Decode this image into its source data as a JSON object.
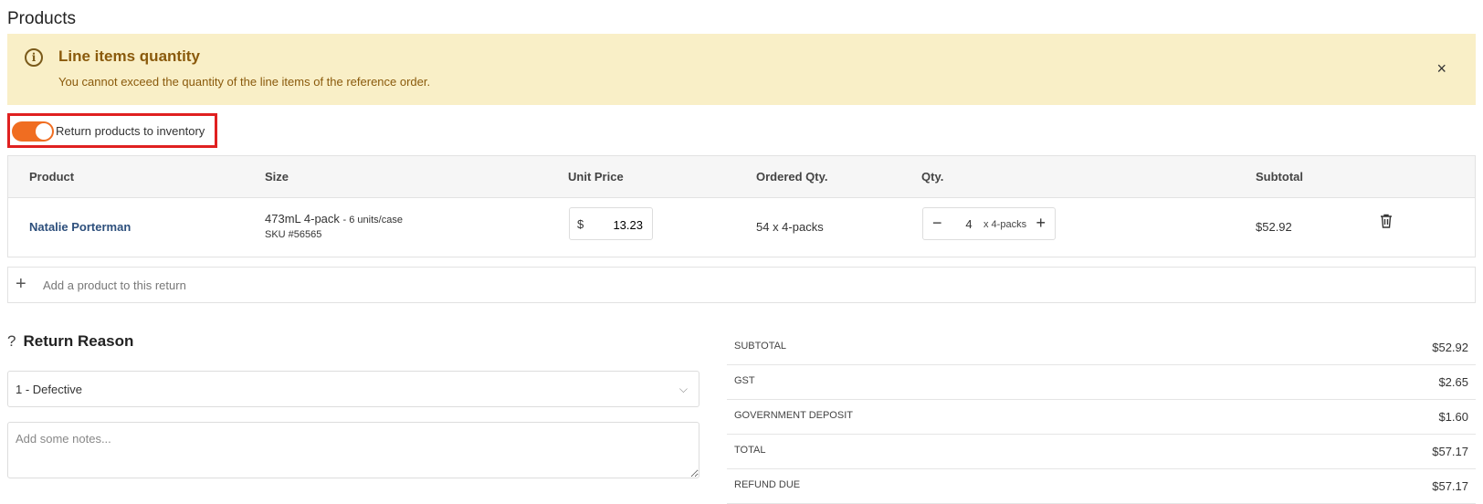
{
  "page_title": "Products",
  "alert": {
    "title": "Line items quantity",
    "message": "You cannot exceed the quantity of the line items of the reference order.",
    "close_label": "×"
  },
  "toggle": {
    "label": "Return products to inventory",
    "on": true,
    "color": "#f06d21"
  },
  "table": {
    "headers": [
      "Product",
      "Size",
      "Unit Price",
      "Ordered Qty.",
      "Qty.",
      "Subtotal"
    ],
    "rows": [
      {
        "product": "Natalie Porterman",
        "size": "473mL 4-pack",
        "units_per_case": "- 6 units/case",
        "sku": "SKU #56565",
        "currency": "$",
        "unit_price": "13.23",
        "ordered_qty": "54 x 4-packs",
        "qty": "4",
        "qty_unit": "x 4-packs",
        "subtotal": "$52.92"
      }
    ]
  },
  "add_product": {
    "label": "Add a product to this return"
  },
  "return_reason": {
    "help": "?",
    "title": "Return Reason",
    "selected": "1 - Defective",
    "notes_placeholder": "Add some notes..."
  },
  "totals": [
    {
      "label": "SUBTOTAL",
      "amount": "$52.92"
    },
    {
      "label": "GST",
      "amount": "$2.65"
    },
    {
      "label": "GOVERNMENT DEPOSIT",
      "amount": "$1.60"
    },
    {
      "label": "TOTAL",
      "amount": "$57.17"
    },
    {
      "label": "REFUND DUE",
      "amount": "$57.17"
    }
  ]
}
